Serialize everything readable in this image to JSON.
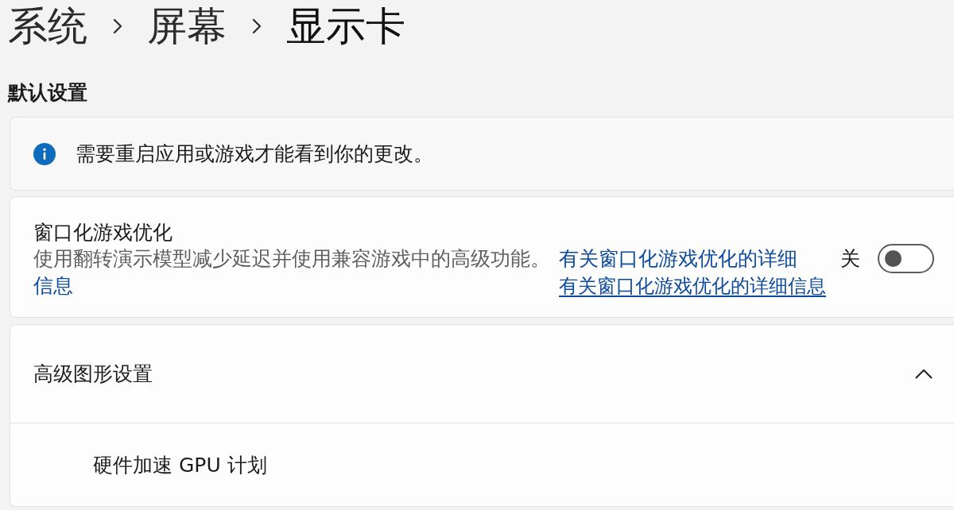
{
  "breadcrumb": [
    "系统",
    "屏幕",
    "显示卡"
  ],
  "section_title": "默认设置",
  "info_bar": {
    "message": "需要重启应用或游戏才能看到你的更改。"
  },
  "windowed_game_optimization": {
    "title": "窗口化游戏优化",
    "description": "使用翻转演示模型减少延迟并使用兼容游戏中的高级功能。",
    "inline_link": {
      "lines": [
        "有关窗口化游戏优化的详细",
        "信息"
      ]
    },
    "link": "有关窗口化游戏优化的详细信息",
    "toggle": {
      "label": "关",
      "on": false
    }
  },
  "advanced_graphics": {
    "title": "高级图形设置",
    "expanded": true,
    "items": [
      {
        "label": "硬件加速 GPU 计划"
      }
    ]
  }
}
